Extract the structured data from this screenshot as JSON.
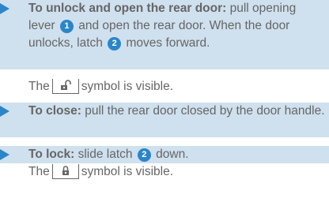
{
  "steps": [
    {
      "label": "To unlock and open the rear door:",
      "text1": " pull opening lever ",
      "num1": "1",
      "text2": " and open the rear door. When the door unlocks, latch ",
      "num2": "2",
      "text3": " moves forward."
    },
    {
      "label": "To close:",
      "text1": " pull the rear door closed by the door handle."
    },
    {
      "label": "To lock:",
      "text1": " slide latch ",
      "num1": "2",
      "text2": " down."
    }
  ],
  "notes": {
    "unlock_pre": "The",
    "unlock_post": "symbol is visible.",
    "lock_pre": "The",
    "lock_post": "symbol is visible."
  },
  "icons": {
    "unlocked": "unlocked-padlock-icon",
    "locked": "locked-padlock-icon"
  },
  "colors": {
    "accent": "#2a86c8",
    "step_background": "#cfe0ee",
    "text": "#666666"
  }
}
